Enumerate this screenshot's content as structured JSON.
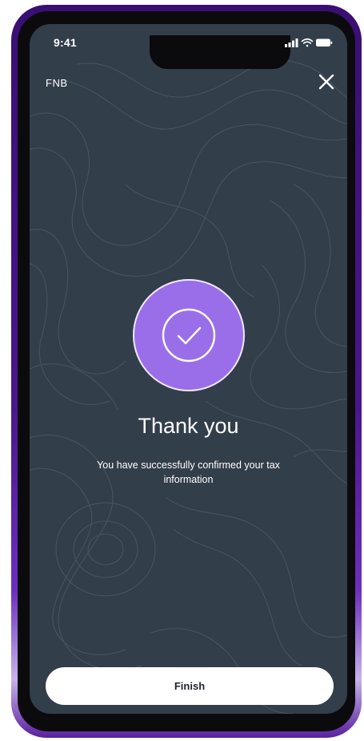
{
  "status_bar": {
    "time": "9:41",
    "signal_icon": "cellular-signal-icon",
    "wifi_icon": "wifi-icon",
    "battery_icon": "battery-icon"
  },
  "header": {
    "brand": "FNB",
    "close_icon": "close-icon"
  },
  "confirmation": {
    "icon": "checkmark-icon",
    "title": "Thank you",
    "message": "You have successfully confirmed your tax information"
  },
  "footer": {
    "finish_label": "Finish"
  },
  "colors": {
    "background": "#333e4b",
    "accent": "#9a6ee8",
    "frame": "#4a168d",
    "button": "#ffffff"
  }
}
